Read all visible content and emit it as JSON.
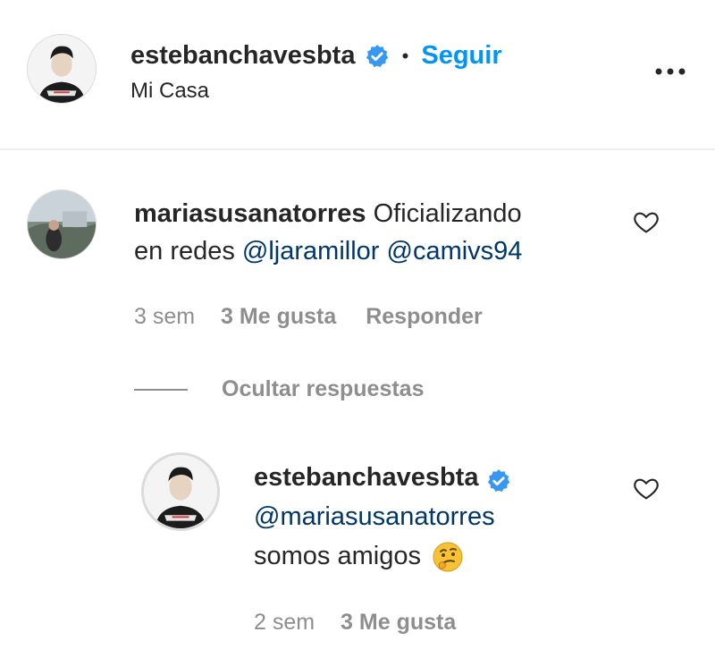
{
  "header": {
    "username": "estebanchavesbta",
    "dot": "•",
    "follow_label": "Seguir",
    "location": "Mi Casa",
    "more_label": "•••"
  },
  "comment": {
    "username": "mariasusanatorres",
    "text_line1": "Oficializando",
    "text_line2_prefix": "en redes",
    "mention1": "@ljaramillor",
    "mention2": "@camivs94",
    "time": "3 sem",
    "likes": "3 Me gusta",
    "reply_label": "Responder"
  },
  "replies_toggle": {
    "label": "Ocultar respuestas"
  },
  "reply": {
    "username": "estebanchavesbta",
    "mention": "@mariasusanatorres",
    "text": "somos amigos",
    "emoji": "thinking-face-icon",
    "time": "2 sem",
    "likes": "3 Me gusta"
  },
  "colors": {
    "link": "#00376b",
    "follow": "#0095f6",
    "verified": "#3897f0",
    "muted": "#8e8e8e"
  }
}
